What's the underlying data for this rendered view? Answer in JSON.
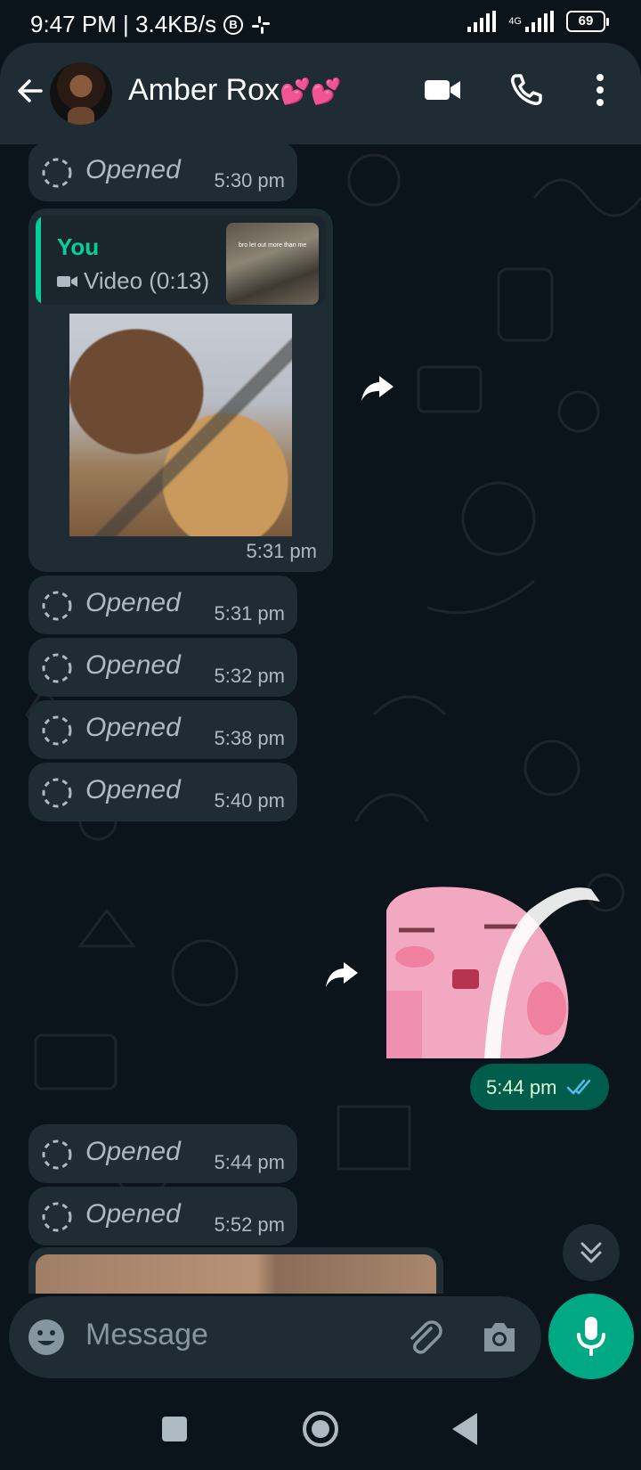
{
  "status_bar": {
    "time_info": "9:47 PM | 3.4KB/s",
    "b_badge": "B",
    "network": "4G",
    "battery": "69"
  },
  "header": {
    "contact_name": "Amber Rox",
    "name_emoji": "💕💕",
    "icons": [
      "back-arrow-icon",
      "video-call-icon",
      "voice-call-icon",
      "more-options-icon"
    ]
  },
  "messages": {
    "opened_label": "Opened",
    "opened_times": [
      "5:30 pm",
      "5:31 pm",
      "5:32 pm",
      "5:38 pm",
      "5:40 pm",
      "5:44 pm",
      "5:52 pm"
    ],
    "reply": {
      "author": "You",
      "quoted": "Video (0:13)",
      "thumb_caption": "bro let out more than me",
      "time": "5:31 pm"
    },
    "sticker_time": "5:44 pm"
  },
  "input": {
    "placeholder": "Message"
  },
  "colors": {
    "accent": "#00a884",
    "bubble_in": "#1f2c34",
    "bubble_out": "#005c4b",
    "read_ticks": "#53bdeb",
    "background": "#0b141a"
  }
}
